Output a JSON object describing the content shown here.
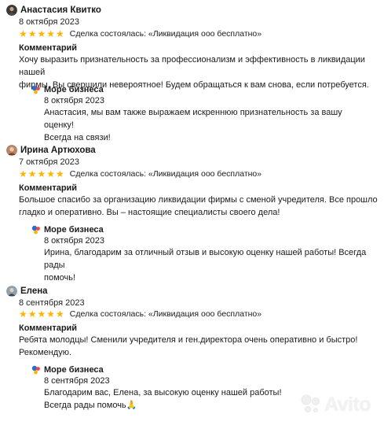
{
  "reviews": [
    {
      "name": "Анастасия Квитко",
      "date": "8 октября 2023",
      "stars": "★★★★★",
      "deal": "Сделка состоялась: «Ликвидация ооо бесплатно»",
      "comment_label": "Комментарий",
      "comment_lines": [
        "Хочу выразить признательность за профессионализм и эффективность в ликвидации нашей",
        "фирмы. Вы свершили невероятное! Будем обращаться к вам снова, если потребуется."
      ],
      "reply": {
        "name": "Море бизнеса",
        "date": "8 октября 2023",
        "lines": [
          "Анастасия, мы вам также выражаем искреннюю признательность за вашу оценку!",
          "Всегда на связи!"
        ]
      }
    },
    {
      "name": "Ирина Артюхова",
      "date": "7 октября 2023",
      "stars": "★★★★★",
      "deal": "Сделка состоялась: «Ликвидация ооо бесплатно»",
      "comment_label": "Комментарий",
      "comment_lines": [
        "Большое спасибо за организацию ликвидации фирмы с сменой учредителя. Все прошло",
        "гладко и оперативно. Вы – настоящие специалисты своего дела!"
      ],
      "reply": {
        "name": "Море бизнеса",
        "date": "8 октября 2023",
        "lines": [
          "Ирина, благодарим за отличный отзыв и высокую оценку нашей работы! Всегда рады",
          "помочь!"
        ]
      }
    },
    {
      "name": "Елена",
      "date": "8 сентября 2023",
      "stars": "★★★★★",
      "deal": "Сделка состоялась: «Ликвидация ооо бесплатно»",
      "comment_label": "Комментарий",
      "comment_lines": [
        "Ребята молодцы! Сменили учредителя и ген.директора очень оперативно и быстро!",
        "Рекомендую."
      ],
      "reply": {
        "name": "Море бизнеса",
        "date": "8 сентября 2023",
        "lines": [
          "Благодарим вас, Елена, за высокую оценку нашей работы!",
          "Всегда рады помочь🙏"
        ]
      }
    }
  ],
  "watermark": {
    "text": "Avito",
    "icon": "avito-logo-icon"
  },
  "colors": {
    "star": "#ffb400",
    "text": "#1a1a1a",
    "background": "#ffffff"
  }
}
